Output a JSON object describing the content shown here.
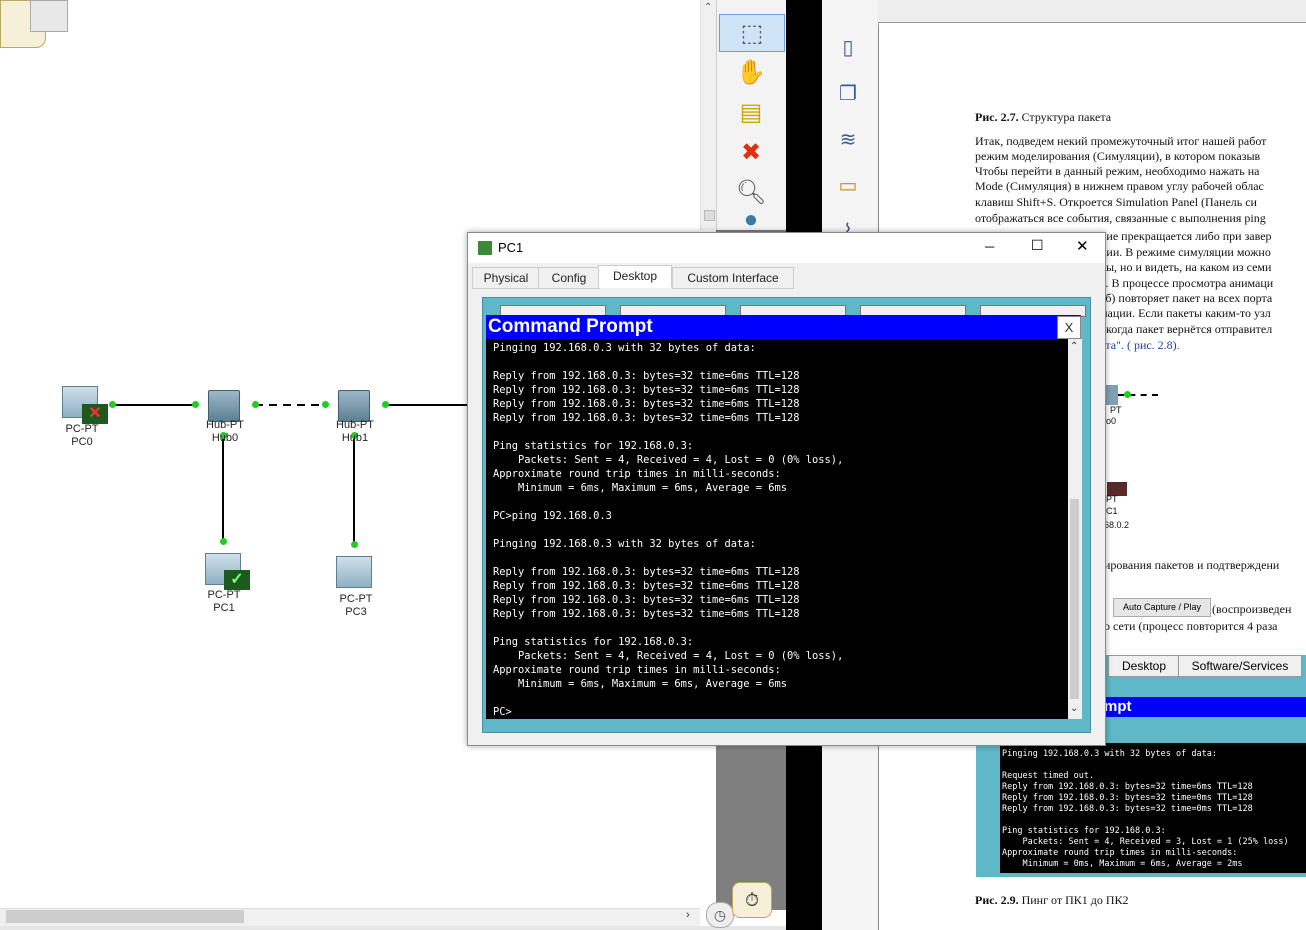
{
  "topology": {
    "nodes": [
      {
        "type": "PC-PT",
        "name": "PC0",
        "status": "failed"
      },
      {
        "type": "Hub-PT",
        "name": "Hub0"
      },
      {
        "type": "Hub-PT",
        "name": "Hub1"
      },
      {
        "type": "PC-PT",
        "name": "PC1",
        "status": "success"
      },
      {
        "type": "PC-PT",
        "name": "PC3"
      }
    ]
  },
  "tools": [
    "select-icon",
    "hand-icon",
    "note-icon",
    "delete-icon",
    "zoom-icon",
    "draw-icon"
  ],
  "window": {
    "title": "PC1",
    "tabs": [
      "Physical",
      "Config",
      "Desktop",
      "Custom Interface"
    ],
    "active_tab": "Desktop",
    "controls": {
      "min": "─",
      "max": "☐",
      "close": "✕"
    }
  },
  "cmd": {
    "title": "Command Prompt",
    "close": "X",
    "lines": [
      "Pinging 192.168.0.3 with 32 bytes of data:",
      "",
      "Reply from 192.168.0.3: bytes=32 time=6ms TTL=128",
      "Reply from 192.168.0.3: bytes=32 time=6ms TTL=128",
      "Reply from 192.168.0.3: bytes=32 time=6ms TTL=128",
      "Reply from 192.168.0.3: bytes=32 time=6ms TTL=128",
      "",
      "Ping statistics for 192.168.0.3:",
      "    Packets: Sent = 4, Received = 4, Lost = 0 (0% loss),",
      "Approximate round trip times in milli-seconds:",
      "    Minimum = 6ms, Maximum = 6ms, Average = 6ms",
      "",
      "PC>ping 192.168.0.3",
      "",
      "Pinging 192.168.0.3 with 32 bytes of data:",
      "",
      "Reply from 192.168.0.3: bytes=32 time=6ms TTL=128",
      "Reply from 192.168.0.3: bytes=32 time=6ms TTL=128",
      "Reply from 192.168.0.3: bytes=32 time=6ms TTL=128",
      "Reply from 192.168.0.3: bytes=32 time=6ms TTL=128",
      "",
      "Ping statistics for 192.168.0.3:",
      "    Packets: Sent = 4, Received = 4, Lost = 0 (0% loss),",
      "Approximate round trip times in milli-seconds:",
      "    Minimum = 6ms, Maximum = 6ms, Average = 6ms",
      "",
      "PC>"
    ]
  },
  "doc": {
    "fig27_label": "Рис. 2.7.",
    "fig27_text": "Структура пакета",
    "paragraph": [
      "Итак, подведем некий промежуточный итог нашей работ",
      "режим моделирования (Симуляции), в котором показыв",
      "Чтобы перейти в данный режим, необходимо нажать на",
      "Mode (Симуляция) в нижнем правом углу рабочей облас",
      "клавиш Shift+S. Откроется Simulation Panel (Панель си",
      "отображаться все события, связанные с выполнения ping"
    ],
    "behind": [
      "ние прекращается либо при завер",
      "ции. В режиме симуляции можно",
      "лы, но и видеть, на каком из семи",
      "я. В процессе просмотра анимаци",
      "аб) повторяет пакет на всех порта",
      "мации. Если пакеты каким-то узл",
      ", когда пакет вернётся отправител",
      "ета\". ( рис. 2.8)."
    ],
    "line_packets": "ирования пакетов и подтверждени",
    "auto_capture": "Auto Capture / Play",
    "play_text": "(воспроизведен",
    "repeat_text": "о сети (процесс повторится 4 раза",
    "mini_labels": [
      "PT",
      "o0",
      "PT",
      "C1",
      "68.0.2"
    ],
    "ss_tabs": [
      "Desktop",
      "Software/Services"
    ],
    "ss_title": "mpt",
    "ss_lines": [
      "Pinging 192.168.0.3 with 32 bytes of data:",
      "",
      "Request timed out.",
      "Reply from 192.168.0.3: bytes=32 time=6ms TTL=128",
      "Reply from 192.168.0.3: bytes=32 time=0ms TTL=128",
      "Reply from 192.168.0.3: bytes=32 time=0ms TTL=128",
      "",
      "Ping statistics for 192.168.0.3:",
      "    Packets: Sent = 4, Received = 3, Lost = 1 (25% loss)",
      "Approximate round trip times in milli-seconds:",
      "    Minimum = 0ms, Maximum = 6ms, Average = 2ms"
    ],
    "fig29_label": "Рис. 2.9.",
    "fig29_text": "Пинг от ПК1 до ПК2"
  },
  "colors": {
    "link_dot": "#22cc22",
    "cmd_title": "#0000ff",
    "desktop_bg": "#5fb8c8"
  }
}
